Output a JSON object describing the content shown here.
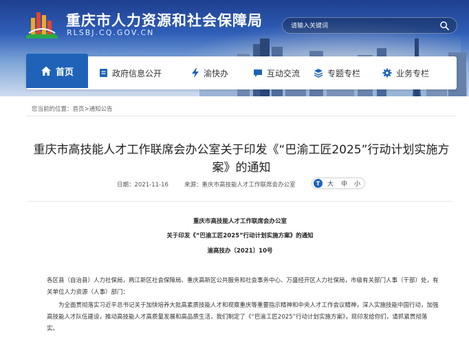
{
  "header": {
    "site_title": "重庆市人力资源和社会保障局",
    "site_domain": "RLSBJ.CQ.GOV.CN",
    "search_placeholder": "请输入关键词"
  },
  "nav": {
    "items": [
      {
        "label": "首页",
        "icon": "home-icon",
        "active": true
      },
      {
        "label": "政府信息公开",
        "icon": "document-icon"
      },
      {
        "label": "渝快办",
        "icon": "lightning-icon"
      },
      {
        "label": "互动交流",
        "icon": "chat-icon"
      },
      {
        "label": "专题专栏",
        "icon": "layers-icon"
      },
      {
        "label": "业务专栏",
        "icon": "gear-icon"
      }
    ]
  },
  "breadcrumb": {
    "prefix": "您当前的位置：",
    "home": "首页",
    "sep": ">",
    "current": "通知公告"
  },
  "article": {
    "title": "重庆市高技能人才工作联席会办公室关于印发《“巴渝工匠2025”行动计划实施方案》的通知",
    "date_label": "日期：",
    "date": "2021-11-16",
    "source_label": "来源：",
    "source": "重庆市高技能人才工作联席会办公室",
    "font_sizes": [
      "大",
      "中",
      "小"
    ],
    "issuer": "重庆市高技能人才工作联席会办公室",
    "doc_title": "关于印发《“巴渝工匠2025”行动计划实施方案》的通知",
    "doc_number": "渝高技办〔2021〕10号",
    "para1": "各区县（自治县）人力社保局，两江新区社会保障局、重庆高新区公共服务和社会事务中心、万盛经开区人力社保局，市级有关部门人事（干部）处，有关单位人力资源（人事）部门：",
    "para2": "为全面贯彻落实习近平总书记关于加快培养大批高素质技能人才和视察重庆等重要指示精神和中央人才工作会议精神，深入实施技能中国行动，加强高技能人才队伍建设，推动高技能人才高质量发展和高品质生活，我们制定了《“巴渝工匠2025”行动计划实施方案》，现印发给你们，请抓紧贯彻落实。"
  }
}
